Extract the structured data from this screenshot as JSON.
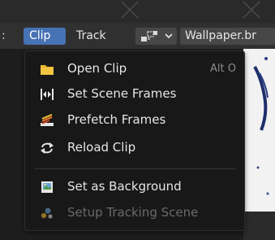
{
  "header": {
    "prev_label": ":",
    "active_menu_label": "Clip",
    "track_label": "Track",
    "mode_icon": "tracking-mode-icon",
    "file_label": "Wallpaper.br"
  },
  "clip_menu": {
    "items": [
      {
        "label": "Open Clip",
        "shortcut": "Alt O",
        "icon": "folder-icon",
        "enabled": true
      },
      {
        "label": "Set Scene Frames",
        "icon": "scene-frames-icon",
        "enabled": true
      },
      {
        "label": "Prefetch Frames",
        "icon": "prefetch-icon",
        "enabled": true
      },
      {
        "label": "Reload Clip",
        "icon": "reload-icon",
        "enabled": true
      },
      {
        "label": "Set as Background",
        "icon": "image-background-icon",
        "enabled": true
      },
      {
        "label": "Setup Tracking Scene",
        "icon": "tracking-scene-icon",
        "enabled": false
      }
    ]
  },
  "colors": {
    "accent": "#4772b3",
    "menu_bg": "#181818",
    "header_bg": "#303030",
    "disabled_text": "#6a6a6a",
    "folder": "#e8b730"
  }
}
